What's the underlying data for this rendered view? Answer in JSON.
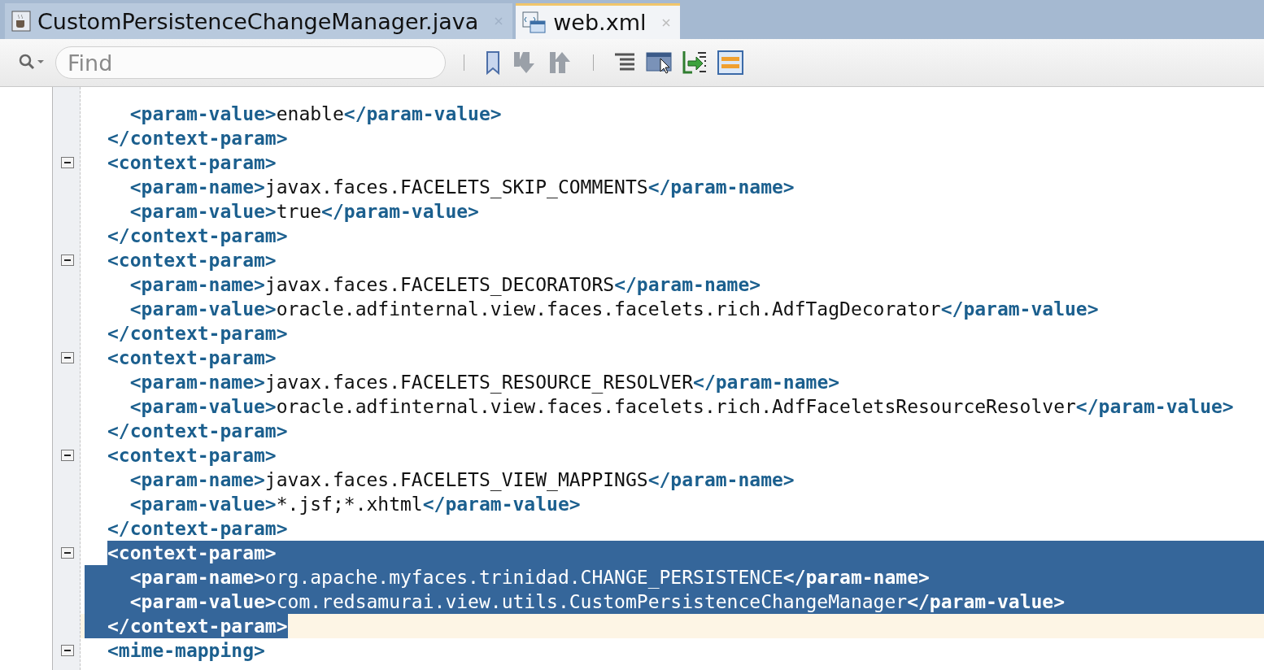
{
  "tabs": [
    {
      "label": "CustomPersistenceChangeManager.java",
      "kind": "java",
      "selected": false
    },
    {
      "label": "web.xml",
      "kind": "xml",
      "selected": true
    }
  ],
  "toolbar": {
    "search": {
      "placeholder": "Find"
    }
  },
  "blocks": [
    {
      "children": [
        {
          "selected": false,
          "current": false,
          "parts": [
            {
              "kind": "tag",
              "text": "<param-value>"
            },
            {
              "kind": "text",
              "text": "enable"
            },
            {
              "kind": "tag",
              "text": "</param-value>"
            }
          ]
        }
      ],
      "close": {
        "selected": false,
        "current": false,
        "parts": [
          {
            "kind": "tag",
            "text": "</context-param>"
          }
        ]
      }
    },
    {
      "open": {
        "fold": true,
        "selected": false,
        "current": false,
        "parts": [
          {
            "kind": "tag",
            "text": "<context-param>"
          }
        ]
      },
      "children": [
        {
          "selected": false,
          "current": false,
          "parts": [
            {
              "kind": "tag",
              "text": "<param-name>"
            },
            {
              "kind": "text",
              "text": "javax.faces.FACELETS_SKIP_COMMENTS"
            },
            {
              "kind": "tag",
              "text": "</param-name>"
            }
          ]
        },
        {
          "selected": false,
          "current": false,
          "parts": [
            {
              "kind": "tag",
              "text": "<param-value>"
            },
            {
              "kind": "text",
              "text": "true"
            },
            {
              "kind": "tag",
              "text": "</param-value>"
            }
          ]
        }
      ],
      "close": {
        "selected": false,
        "current": false,
        "parts": [
          {
            "kind": "tag",
            "text": "</context-param>"
          }
        ]
      }
    },
    {
      "open": {
        "fold": true,
        "selected": false,
        "current": false,
        "parts": [
          {
            "kind": "tag",
            "text": "<context-param>"
          }
        ]
      },
      "children": [
        {
          "selected": false,
          "current": false,
          "parts": [
            {
              "kind": "tag",
              "text": "<param-name>"
            },
            {
              "kind": "text",
              "text": "javax.faces.FACELETS_DECORATORS"
            },
            {
              "kind": "tag",
              "text": "</param-name>"
            }
          ]
        },
        {
          "selected": false,
          "current": false,
          "parts": [
            {
              "kind": "tag",
              "text": "<param-value>"
            },
            {
              "kind": "text",
              "text": "oracle.adfinternal.view.faces.facelets.rich.AdfTagDecorator"
            },
            {
              "kind": "tag",
              "text": "</param-value>"
            }
          ]
        }
      ],
      "close": {
        "selected": false,
        "current": false,
        "parts": [
          {
            "kind": "tag",
            "text": "</context-param>"
          }
        ]
      }
    },
    {
      "open": {
        "fold": true,
        "selected": false,
        "current": false,
        "parts": [
          {
            "kind": "tag",
            "text": "<context-param>"
          }
        ]
      },
      "children": [
        {
          "selected": false,
          "current": false,
          "parts": [
            {
              "kind": "tag",
              "text": "<param-name>"
            },
            {
              "kind": "text",
              "text": "javax.faces.FACELETS_RESOURCE_RESOLVER"
            },
            {
              "kind": "tag",
              "text": "</param-name>"
            }
          ]
        },
        {
          "selected": false,
          "current": false,
          "parts": [
            {
              "kind": "tag",
              "text": "<param-value>"
            },
            {
              "kind": "text",
              "text": "oracle.adfinternal.view.faces.facelets.rich.AdfFaceletsResourceResolver"
            },
            {
              "kind": "tag",
              "text": "</param-value>"
            }
          ]
        }
      ],
      "close": {
        "selected": false,
        "current": false,
        "parts": [
          {
            "kind": "tag",
            "text": "</context-param>"
          }
        ]
      }
    },
    {
      "open": {
        "fold": true,
        "selected": false,
        "current": false,
        "parts": [
          {
            "kind": "tag",
            "text": "<context-param>"
          }
        ]
      },
      "children": [
        {
          "selected": false,
          "current": false,
          "parts": [
            {
              "kind": "tag",
              "text": "<param-name>"
            },
            {
              "kind": "text",
              "text": "javax.faces.FACELETS_VIEW_MAPPINGS"
            },
            {
              "kind": "tag",
              "text": "</param-name>"
            }
          ]
        },
        {
          "selected": false,
          "current": false,
          "parts": [
            {
              "kind": "tag",
              "text": "<param-value>"
            },
            {
              "kind": "text",
              "text": "*.jsf;*.xhtml"
            },
            {
              "kind": "tag",
              "text": "</param-value>"
            }
          ]
        }
      ],
      "close": {
        "selected": false,
        "current": false,
        "parts": [
          {
            "kind": "tag",
            "text": "</context-param>"
          }
        ]
      }
    },
    {
      "open": {
        "fold": true,
        "selected": true,
        "current": false,
        "parts": [
          {
            "kind": "tag",
            "text": "<context-param>"
          }
        ]
      },
      "children": [
        {
          "selected": true,
          "current": false,
          "parts": [
            {
              "kind": "tag",
              "text": "<param-name>"
            },
            {
              "kind": "text",
              "text": "org.apache.myfaces.trinidad.CHANGE_PERSISTENCE"
            },
            {
              "kind": "tag",
              "text": "</param-name>"
            }
          ]
        },
        {
          "selected": true,
          "current": false,
          "parts": [
            {
              "kind": "tag",
              "text": "<param-value>"
            },
            {
              "kind": "text",
              "text": "com.redsamurai.view.utils.CustomPersistenceChangeManager"
            },
            {
              "kind": "tag",
              "text": "</param-value>"
            }
          ]
        }
      ],
      "close": {
        "selected": true,
        "current": true,
        "parts": [
          {
            "kind": "tag",
            "text": "</context-param>"
          }
        ]
      }
    },
    {
      "open": {
        "fold": true,
        "selected": false,
        "current": false,
        "parts": [
          {
            "kind": "tag",
            "text": "<mime-mapping>"
          }
        ]
      }
    }
  ]
}
